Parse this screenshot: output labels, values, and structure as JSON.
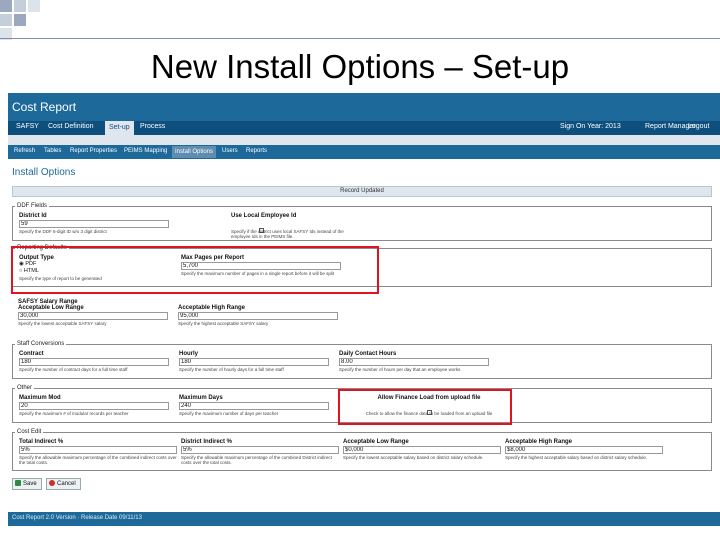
{
  "slide": {
    "title": "New Install Options – Set-up"
  },
  "app": {
    "title": "Cost Report",
    "nav": [
      {
        "label": "SAFSY"
      },
      {
        "label": "Cost Definition"
      },
      {
        "label": "Set-up"
      },
      {
        "label": "Process"
      }
    ],
    "nav_right": {
      "year": "Sign On Year: 2013",
      "user": "Report Manager",
      "logout": "Logout"
    },
    "subnav": [
      {
        "label": "Refresh"
      },
      {
        "label": "Tables"
      },
      {
        "label": "Report Properties"
      },
      {
        "label": "PEIMS Mapping"
      },
      {
        "label": "Install Options"
      },
      {
        "label": "Users"
      },
      {
        "label": "Reports"
      }
    ],
    "page_heading": "Install Options",
    "save_bar": "Record Updated",
    "sections": {
      "ddf": {
        "legend": "DDF Fields",
        "district_id": {
          "label": "District Id",
          "value": "59",
          "hint": "Specify the DDF 6-digit ID w/o 3 digit district"
        },
        "use_local_employee_id": {
          "label": "Use Local Employee Id",
          "hint": "Specify if the district uses local SAFSY Ids instead of the employee Ids in the PEIMS file."
        }
      },
      "reporting": {
        "legend": "Reporting Defaults",
        "output_type": {
          "label": "Output Type",
          "options": [
            "PDF",
            "HTML"
          ],
          "selected": "PDF",
          "hint": "Specify the type of report to be generated"
        },
        "max_pages": {
          "label": "Max Pages per Report",
          "value": "5,700",
          "hint": "Specify the maximum number of pages in a single report before it will be split"
        }
      },
      "salary": {
        "legend": "SAFSY Salary Range",
        "low": {
          "label": "Acceptable Low Range",
          "value": "30,000",
          "hint": "Specify the lowest acceptable SAFSY salary"
        },
        "high": {
          "label": "Acceptable High Range",
          "value": "95,000",
          "hint": "Specify the highest acceptable SAFSY salary"
        }
      },
      "staff": {
        "legend": "Staff Conversions",
        "contract": {
          "label": "Contract",
          "value": "180",
          "hint": "Specify the number of contract days for a full time staff"
        },
        "hourly": {
          "label": "Hourly",
          "value": "180",
          "hint": "Specify the number of hourly days for a full time staff"
        },
        "daily_contact": {
          "label": "Daily Contact Hours",
          "value": "8.00",
          "hint": "Specify the number of hours per day that an employee works"
        }
      },
      "other": {
        "legend": "Other",
        "maximum_mod": {
          "label": "Maximum Mod",
          "value": "20",
          "hint": "Specify the maximum # of modular records per teacher"
        },
        "maximum_days": {
          "label": "Maximum Days",
          "value": "240",
          "hint": "Specify the maximum number of days per teacher"
        },
        "allow_finance": {
          "label": "Allow Finance Load from upload file",
          "hint": "Check to allow the finance data to be loaded from an upload file"
        }
      },
      "cost": {
        "legend": "Cost Edit",
        "total_indirect": {
          "label": "Total Indirect %",
          "value": "5%",
          "hint": "Specify the allowable maximum percentage of the combined indirect costs over the total costs."
        },
        "district_indirect": {
          "label": "District Indirect %",
          "value": "5%",
          "hint": "Specify the allowable maximum percentage of the combined District indirect costs over the total costs."
        },
        "low_range": {
          "label": "Acceptable Low Range",
          "value": "$0,000",
          "hint": "Specify the lowest acceptable salary based on district salary schedule."
        },
        "high_range": {
          "label": "Acceptable High Range",
          "value": "$8,000",
          "hint": "Specify the highest acceptable salary based on district salary schedule."
        }
      }
    },
    "buttons": {
      "save": "Save",
      "cancel": "Cancel"
    },
    "footer": "Cost Report 2.0 Version · Release Date 09/11/13"
  },
  "colors": {
    "header": "#1d6a9a",
    "nav": "#0e4f7d",
    "highlight": "#e0141e"
  }
}
